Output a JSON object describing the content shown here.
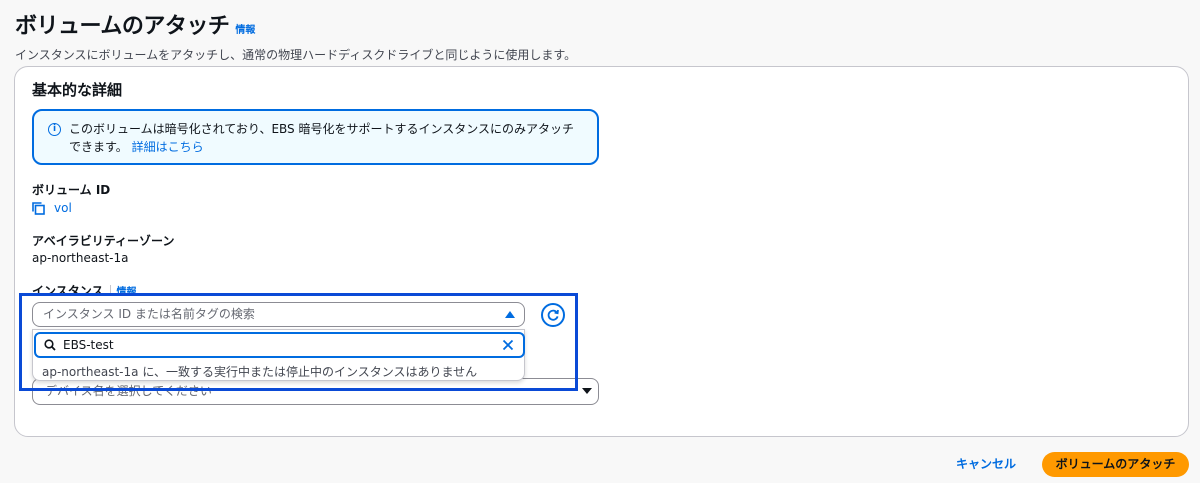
{
  "header": {
    "title": "ボリュームのアタッチ",
    "info_link": "情報",
    "description": "インスタンスにボリュームをアタッチし、通常の物理ハードディスクドライブと同じように使用します。"
  },
  "section": {
    "title": "基本的な詳細",
    "alert": {
      "icon": "info-icon",
      "text": "このボリュームは暗号化されており、EBS 暗号化をサポートするインスタンスにのみアタッチできます。",
      "link": "詳細はこちら"
    },
    "volume_id": {
      "label": "ボリューム ID",
      "icon": "copy-icon",
      "value": "vol"
    },
    "availability_zone": {
      "label": "アベイラビリティーゾーン",
      "value": "ap-northeast-1a"
    },
    "instance": {
      "label": "インスタンス",
      "info_link": "情報",
      "placeholder": "インスタンス ID または名前タグの検索",
      "search_value": "EBS-test",
      "empty_message": "ap-northeast-1a に、一致する実行中または停止中のインスタンスはありません"
    },
    "device": {
      "placeholder": "デバイス名を選択してください"
    }
  },
  "footer": {
    "cancel_label": "キャンセル",
    "attach_label": "ボリュームのアタッチ"
  },
  "colors": {
    "accent": "#006ce0",
    "primary_button": "#ff9900",
    "highlight_box": "#0a4ad6"
  }
}
